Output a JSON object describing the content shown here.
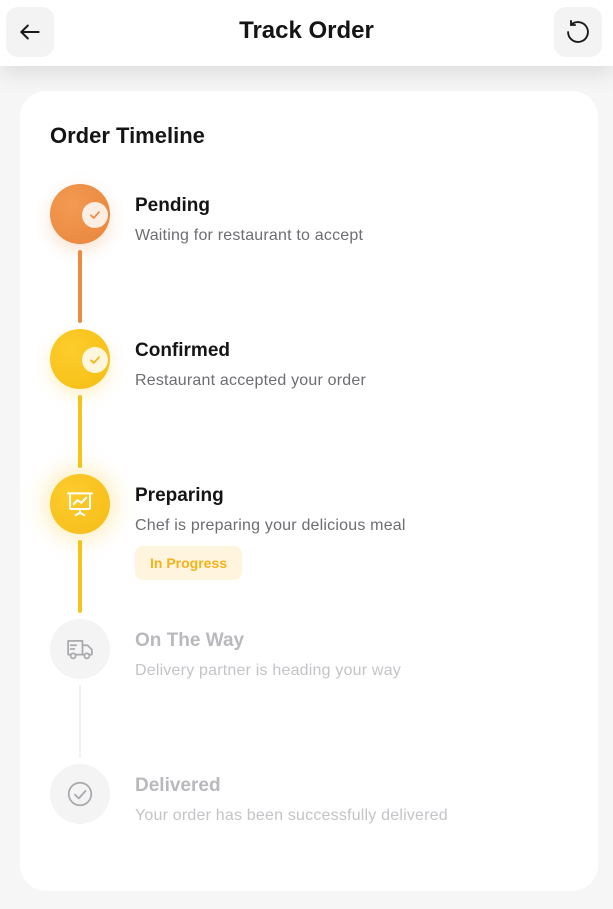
{
  "header": {
    "title": "Track Order",
    "back_icon": "arrow-left-icon",
    "refresh_icon": "refresh-icon"
  },
  "timeline": {
    "title": "Order Timeline",
    "steps": [
      {
        "title": "Pending",
        "description": "Waiting for restaurant to accept",
        "status": "completed",
        "icon": "check-icon",
        "color": "#ec8c43"
      },
      {
        "title": "Confirmed",
        "description": "Restaurant accepted your order",
        "status": "completed",
        "icon": "check-icon",
        "color": "#f8c318"
      },
      {
        "title": "Preparing",
        "description": "Chef is preparing your delicious meal",
        "status": "in-progress",
        "badge": "In Progress",
        "icon": "presentation-chart-icon",
        "color": "#f7c21b"
      },
      {
        "title": "On The Way",
        "description": "Delivery partner is heading your way",
        "status": "pending",
        "icon": "delivery-truck-icon",
        "color": "#f4f4f5"
      },
      {
        "title": "Delivered",
        "description": "Your order has been successfully delivered",
        "status": "pending",
        "icon": "check-circle-icon",
        "color": "#f4f4f5"
      }
    ]
  }
}
